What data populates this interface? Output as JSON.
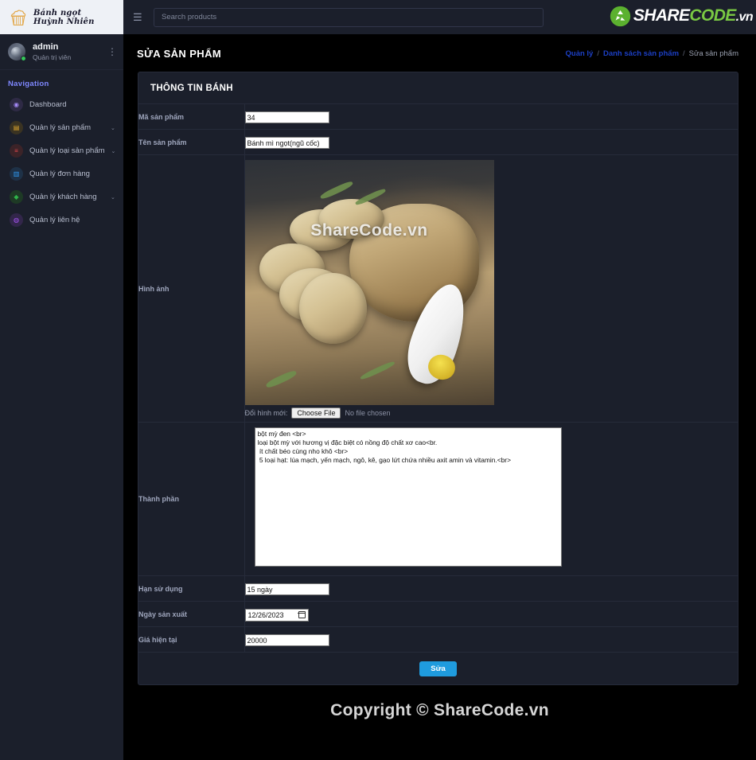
{
  "brand": {
    "line1": "Bánh ngọt",
    "line2": "Huỳnh Nhiên",
    "icon": "cupcake-icon"
  },
  "profile": {
    "name": "admin",
    "role": "Quản trị viên",
    "menu_icon": "vertical-dots-icon"
  },
  "sidebar": {
    "nav_heading": "Navigation",
    "items": [
      {
        "label": "Dashboard",
        "icon": "speedometer-icon",
        "color": "#8b5cf6",
        "caret": ""
      },
      {
        "label": "Quản lý sản phẩm",
        "icon": "box-icon",
        "color": "#e0a82e",
        "caret": "⌄"
      },
      {
        "label": "Quản lý loại sản phẩm",
        "icon": "list-icon",
        "color": "#e5484d",
        "caret": "⌄"
      },
      {
        "label": "Quản lý đơn hàng",
        "icon": "clipboard-icon",
        "color": "#2f9bf5",
        "caret": ""
      },
      {
        "label": "Quản lý khách hàng",
        "icon": "user-shield-icon",
        "color": "#2fb44a",
        "caret": "⌄"
      },
      {
        "label": "Quản lý liên hệ",
        "icon": "contact-icon",
        "color": "#a855f7",
        "caret": ""
      }
    ]
  },
  "topbar": {
    "menu_toggle_icon": "hamburger-icon",
    "search_placeholder": "Search products",
    "search_value": "",
    "logo": {
      "share": "SHARE",
      "code": "CODE",
      "vn": ".vn",
      "mark_icon": "sharecode-recycle-icon"
    }
  },
  "page": {
    "title": "SỬA SẢN PHẨM",
    "breadcrumb": [
      {
        "label": "Quản lý",
        "type": "link"
      },
      {
        "label": "/",
        "type": "sep"
      },
      {
        "label": "Danh sách sản phẩm",
        "type": "link"
      },
      {
        "label": "/",
        "type": "sep"
      },
      {
        "label": "Sửa sản phẩm",
        "type": "current"
      }
    ]
  },
  "form": {
    "card_title": "THÔNG TIN BÁNH",
    "labels": {
      "code": "Mã sản phẩm",
      "name": "Tên sản phẩm",
      "image": "Hình ảnh",
      "ingredients": "Thành phần",
      "expiry": "Hạn sử dụng",
      "production_date": "Ngày sản xuất",
      "price": "Giá hiện tại"
    },
    "values": {
      "code": "34",
      "name": "Bánh mì ngọt(ngũ cốc)",
      "ingredients": "bột mỳ đen <br>\nloại bột mỳ với hương vị đặc biệt có nồng độ chất xơ cao<br.\n ít chất béo cùng nho khô <br>\n 5 loại hạt: lúa mạch, yến mạch, ngô, kê, gạo lứt chứa nhiều axit amin và vitamin.<br>",
      "expiry": "15 ngày",
      "production_date": "12/26/2023",
      "price": "20000"
    },
    "image_upload": {
      "label": "Đổi hình mới:",
      "button": "Choose File",
      "status": "No file chosen",
      "watermark": "ShareCode.vn"
    },
    "submit_label": "Sửa"
  },
  "footer": {
    "text": "Copyright © ShareCode.vn"
  }
}
